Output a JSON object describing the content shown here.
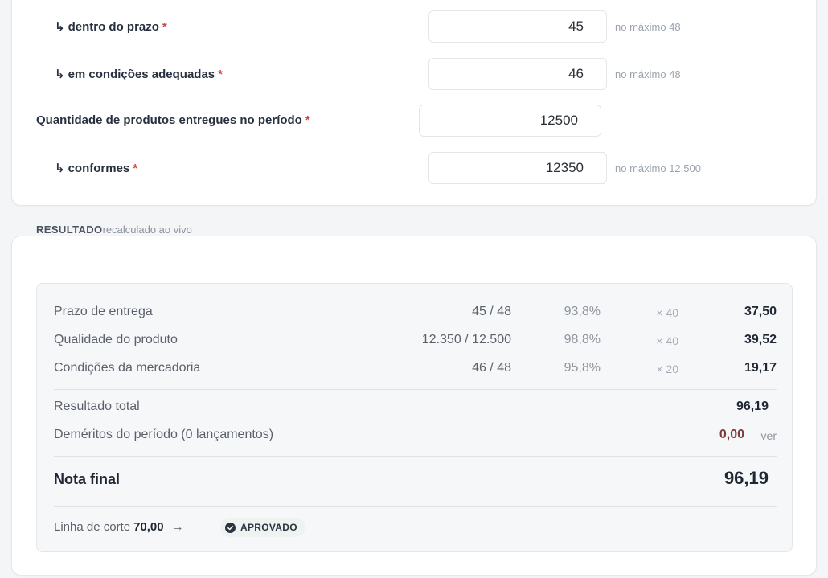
{
  "form": {
    "fields": [
      {
        "label": "dentro do prazo",
        "value": "45",
        "hint": "no máximo 48",
        "sub": true
      },
      {
        "label": "em condições adequadas",
        "value": "46",
        "hint": "no máximo 48",
        "sub": true
      },
      {
        "label": "Quantidade de produtos entregues no período",
        "value": "12500",
        "hint": "",
        "sub": false
      },
      {
        "label": "conformes",
        "value": "12350",
        "hint": "no máximo 12.500",
        "sub": true
      }
    ],
    "required_mark": "*",
    "sub_arrow": "↳"
  },
  "result": {
    "heading": "RESULTADO",
    "heading_note": "recalculado ao vivo",
    "criteria": [
      {
        "name": "Prazo de entrega",
        "ratio": "45 / 48",
        "pct": "93,8%",
        "weight": "× 40",
        "points": "37,50"
      },
      {
        "name": "Qualidade do produto",
        "ratio": "12.350 / 12.500",
        "pct": "98,8%",
        "weight": "× 40",
        "points": "39,52"
      },
      {
        "name": "Condições da mercadoria",
        "ratio": "46 / 48",
        "pct": "95,8%",
        "weight": "× 20",
        "points": "19,17"
      }
    ],
    "total_label": "Resultado total",
    "total_value": "96,19",
    "demerits_label": "Deméritos do período (0 lançamentos)",
    "demerits_value": "0,00",
    "demerits_link": "ver",
    "final_label": "Nota final",
    "final_value": "96,19",
    "cutoff_label": "Linha de corte",
    "cutoff_value": "70,00",
    "cutoff_arrow": "→",
    "status": "APROVADO",
    "status_icon": "check-circle-icon"
  },
  "colors": {
    "required": "#d14343",
    "demerit": "#7d3b3b",
    "status_bg": "#eef2f1"
  }
}
